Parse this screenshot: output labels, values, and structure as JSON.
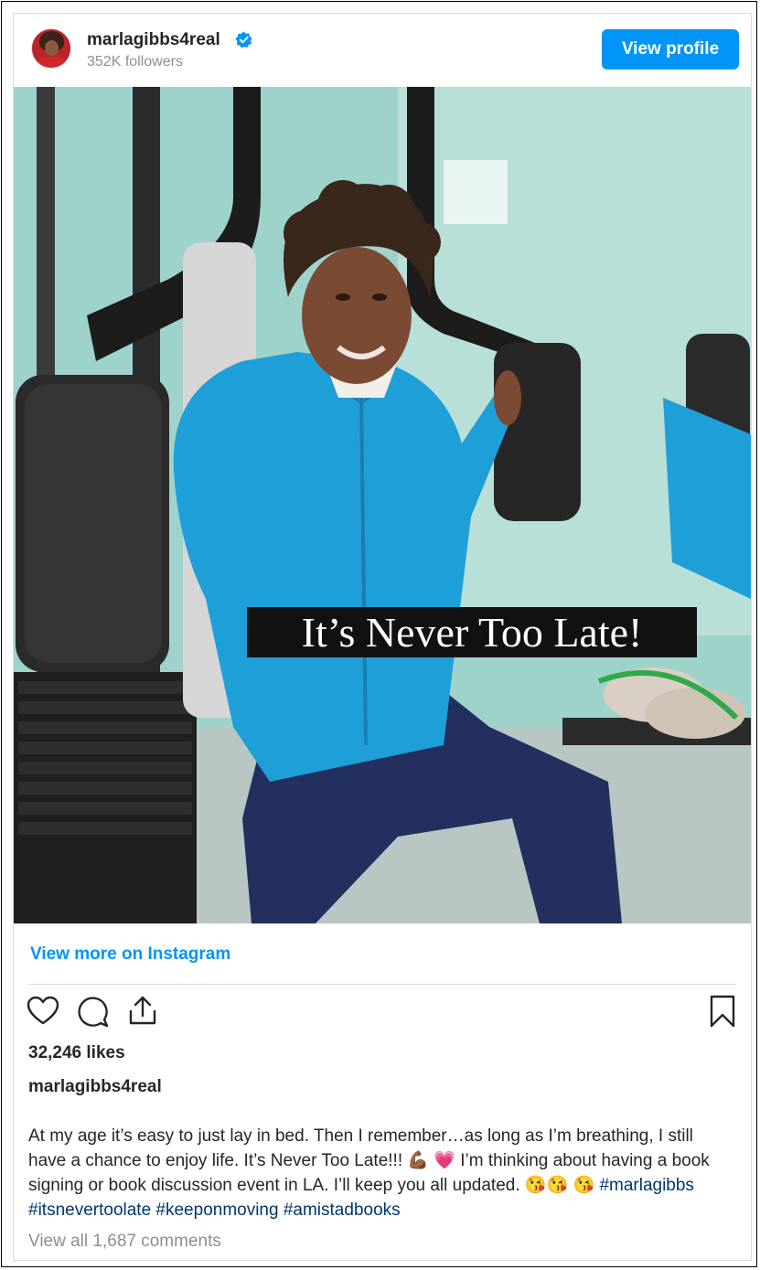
{
  "header": {
    "username": "marlagibbs4real",
    "followers": "352K followers",
    "view_profile_label": "View profile"
  },
  "post": {
    "overlay_text": "It’s Never Too Late!",
    "view_more_label": "View more on Instagram",
    "likes": "32,246 likes",
    "author": "marlagibbs4real",
    "caption_text": "At my age it’s easy to just lay in bed. Then I remember…as long as I’m breathing, I still have a chance to enjoy life. It’s Never Too Late!!! 💪🏾 💗 I’m thinking about having a book signing or book discussion event in LA. I’ll keep you all updated. 😘😘 😘",
    "caption_hashtags": "#marlagibbs #itsnevertoolate #keeponmoving #amistadbooks",
    "view_comments": "View all 1,687 comments"
  },
  "icons": {
    "verified": "verified-badge-icon",
    "like": "heart-icon",
    "comment": "comment-bubble-icon",
    "share": "share-icon",
    "save": "bookmark-icon"
  },
  "colors": {
    "accent": "#0095f6",
    "hashtag": "#00376b",
    "muted": "#8e8e8e",
    "jacket": "#1f9fd8",
    "pants": "#23305f"
  }
}
